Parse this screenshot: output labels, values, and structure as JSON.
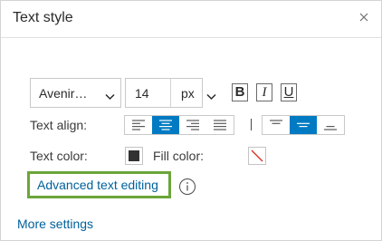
{
  "header": {
    "title": "Text style",
    "close_icon": "close-icon"
  },
  "font": {
    "family_selected": "Avenir…",
    "size_value": "14",
    "size_unit": "px",
    "bold_label": "B",
    "italic_label": "I",
    "underline_label": "U"
  },
  "alignment": {
    "label": "Text align:",
    "horizontal": [
      {
        "name": "align-left",
        "active": false
      },
      {
        "name": "align-center",
        "active": true
      },
      {
        "name": "align-right",
        "active": false
      },
      {
        "name": "align-justify",
        "active": false
      }
    ],
    "vertical": [
      {
        "name": "align-top",
        "active": false
      },
      {
        "name": "align-middle",
        "active": true
      },
      {
        "name": "align-bottom",
        "active": false
      }
    ]
  },
  "colors": {
    "text_label": "Text color:",
    "text_color": "#323232",
    "fill_label": "Fill color:",
    "fill_color": "none",
    "accent": "#007ac2",
    "link": "#00619b",
    "highlight_border": "#6ba53a"
  },
  "advanced": {
    "link_text": "Advanced text editing",
    "info_icon": "info-icon"
  },
  "footer": {
    "more_settings": "More settings"
  }
}
